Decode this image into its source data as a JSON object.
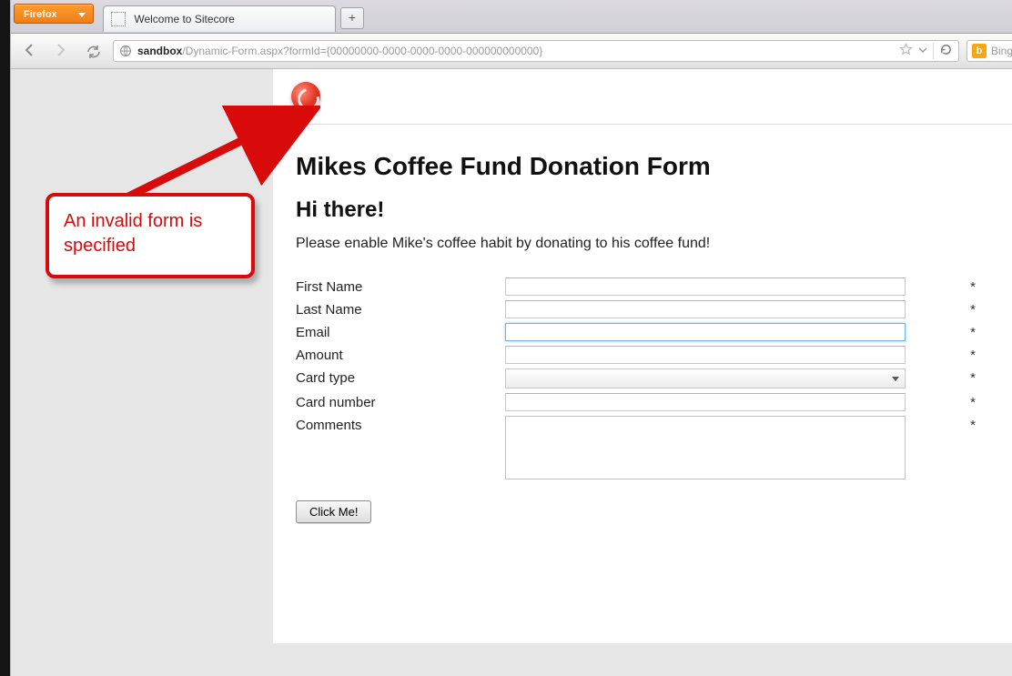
{
  "browser": {
    "menu_label": "Firefox",
    "tab_title": "Welcome to Sitecore",
    "new_tab_symbol": "+",
    "url_host": "sandbox",
    "url_path": "/Dynamic-Form.aspx?formId={00000000-0000-0000-0000-000000000000}",
    "search_engine": "Bing",
    "search_icon_letter": "b"
  },
  "annotation": {
    "text": "An invalid form is specified"
  },
  "page": {
    "title": "Mikes Coffee Fund Donation Form",
    "greeting": "Hi there!",
    "intro": "Please enable Mike's coffee habit by donating to his coffee fund!",
    "fields": {
      "first_name": {
        "label": "First Name",
        "required": "*"
      },
      "last_name": {
        "label": "Last Name",
        "required": "*"
      },
      "email": {
        "label": "Email",
        "required": "*"
      },
      "amount": {
        "label": "Amount",
        "required": "*"
      },
      "card_type": {
        "label": "Card type",
        "required": "*"
      },
      "card_number": {
        "label": "Card number",
        "required": "*"
      },
      "comments": {
        "label": "Comments",
        "required": "*"
      }
    },
    "submit_label": "Click Me!"
  }
}
